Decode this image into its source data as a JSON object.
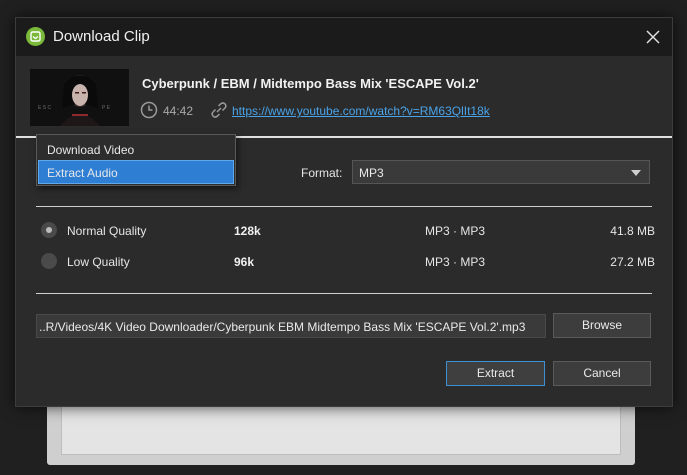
{
  "dialog": {
    "title": "Download Clip",
    "app_icon": "app-logo-icon",
    "close_icon": "close-icon"
  },
  "video": {
    "title": "Cyberpunk / EBM / Midtempo Bass Mix 'ESCAPE Vol.2'",
    "duration": "44:42",
    "url": "https://www.youtube.com/watch?v=RM63QlIt18k",
    "thumbnail_icon": "video-thumbnail"
  },
  "mode_menu": {
    "items": [
      {
        "label": "Download Video",
        "selected": false
      },
      {
        "label": "Extract Audio",
        "selected": true
      }
    ]
  },
  "format": {
    "label": "Format:",
    "value": "MP3"
  },
  "qualities": [
    {
      "label": "Normal Quality",
      "bitrate": "128k",
      "format": "MP3 · MP3",
      "size": "41.8 MB",
      "selected": true
    },
    {
      "label": "Low Quality",
      "bitrate": "96k",
      "format": "MP3 · MP3",
      "size": "27.2 MB",
      "selected": false
    }
  ],
  "output": {
    "path": "..R/Videos/4K Video Downloader/Cyberpunk   EBM   Midtempo Bass Mix 'ESCAPE Vol.2'.mp3",
    "browse_label": "Browse"
  },
  "actions": {
    "extract_label": "Extract",
    "cancel_label": "Cancel"
  },
  "colors": {
    "accent": "#2e7fd4",
    "link": "#4aa3e8",
    "app_icon": "#7ab93a"
  }
}
